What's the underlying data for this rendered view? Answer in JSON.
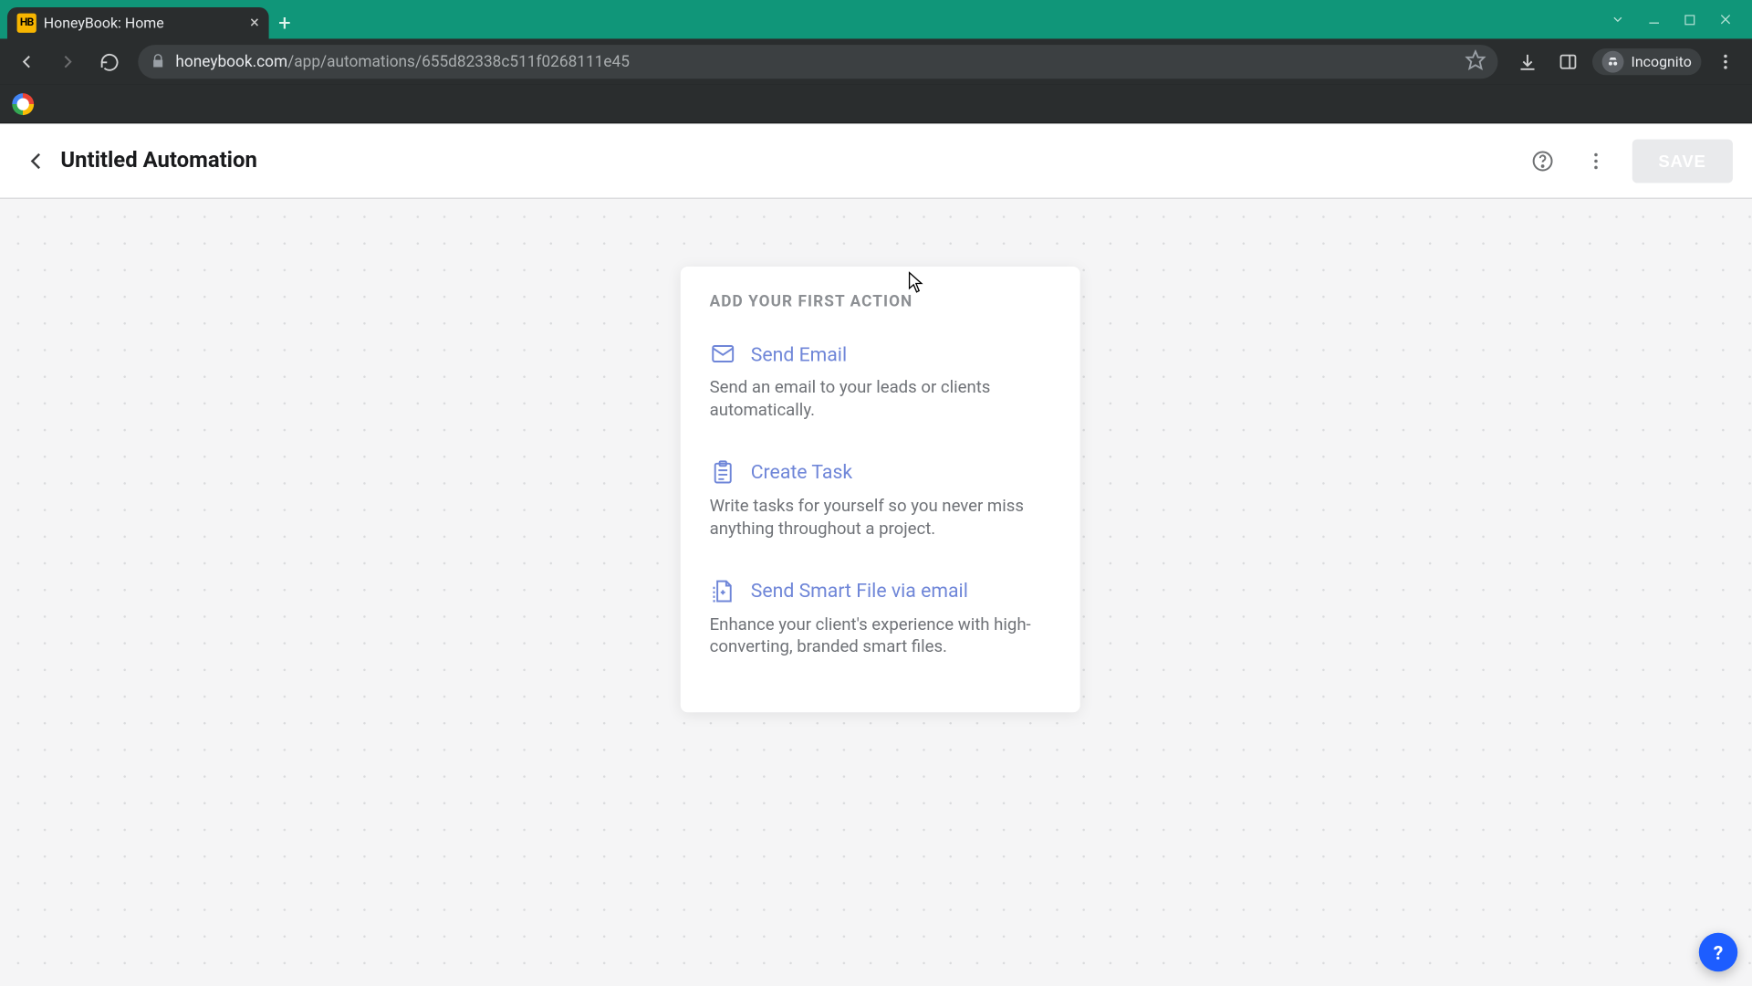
{
  "browser": {
    "tab_title": "HoneyBook: Home",
    "favicon_text": "HB",
    "url_host": "honeybook.com",
    "url_path": "/app/automations/655d82338c511f0268111e45",
    "incognito_label": "Incognito"
  },
  "app_header": {
    "title": "Untitled Automation",
    "save_label": "SAVE"
  },
  "card": {
    "heading": "ADD YOUR FIRST ACTION",
    "actions": [
      {
        "title": "Send Email",
        "desc": "Send an email to your leads or clients automatically."
      },
      {
        "title": "Create Task",
        "desc": "Write tasks for yourself so you never miss anything throughout a project."
      },
      {
        "title": "Send Smart File via email",
        "desc": "Enhance your client's experience with high-converting, branded smart files."
      }
    ]
  },
  "fab": {
    "label": "?"
  }
}
